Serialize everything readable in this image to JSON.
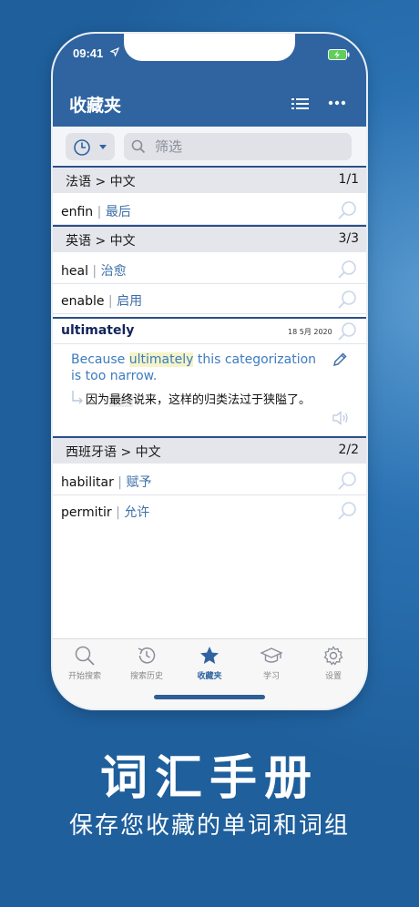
{
  "status": {
    "time": "09:41"
  },
  "nav": {
    "title": "收藏夹",
    "list_icon": "list-icon",
    "more_icon": "more-icon"
  },
  "search": {
    "placeholder": "筛选",
    "history_icon": "clock-icon"
  },
  "groups": [
    {
      "title": "法语 > 中文",
      "count": "1/1",
      "items": [
        {
          "word": "enfin",
          "translation": "最后"
        }
      ]
    },
    {
      "title": "英语 > 中文",
      "count": "3/3",
      "items": [
        {
          "word": "heal",
          "translation": "治愈"
        },
        {
          "word": "enable",
          "translation": "启用"
        },
        {
          "word": "ultimately",
          "date": "18 5月 2020",
          "example": {
            "before": "Because ",
            "highlight": "ultimately",
            "after": " this categorization is too narrow.",
            "tr_before": "因为",
            "tr_highlight": "最终",
            "tr_after": "说来，这样的归类法过于狭隘了。"
          }
        }
      ]
    },
    {
      "title": "西班牙语 > 中文",
      "count": "2/2",
      "items": [
        {
          "word": "habilitar",
          "translation": "赋予"
        },
        {
          "word": "permitir",
          "translation": "允许"
        }
      ]
    }
  ],
  "tabs": [
    {
      "label": "开始搜索",
      "icon": "search-icon"
    },
    {
      "label": "搜索历史",
      "icon": "history-icon"
    },
    {
      "label": "收藏夹",
      "icon": "star-icon",
      "active": true
    },
    {
      "label": "学习",
      "icon": "graduation-cap-icon"
    },
    {
      "label": "设置",
      "icon": "gear-icon"
    }
  ],
  "caption": {
    "main": "词汇手册",
    "sub": "保存您收藏的单词和词组"
  },
  "colors": {
    "accent": "#2f64a0",
    "background": "#1f5f9c",
    "translation": "#3d6fa8"
  }
}
